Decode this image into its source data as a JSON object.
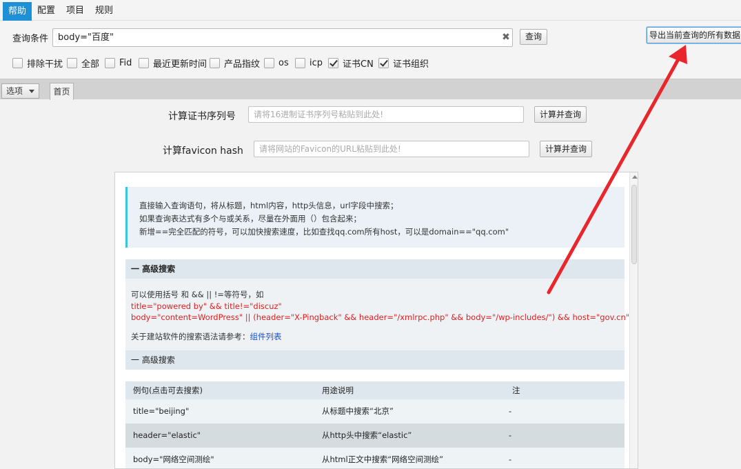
{
  "menu": {
    "items": [
      "帮助",
      "配置",
      "项目",
      "规则"
    ]
  },
  "toolbar": {
    "query_label": "查询条件",
    "query_value": "body=\"百度\"",
    "clear_glyph": "✖",
    "search_button": "查询",
    "export_button": "导出当前查询的所有数据",
    "filters": [
      {
        "label": "排除干扰",
        "checked": false
      },
      {
        "label": "全部",
        "checked": false
      },
      {
        "label": "Fid",
        "checked": false
      },
      {
        "label": "最近更新时间",
        "checked": false
      },
      {
        "label": "产品指纹",
        "checked": false
      },
      {
        "label": "os",
        "checked": false
      },
      {
        "label": "icp",
        "checked": false
      },
      {
        "label": "证书CN",
        "checked": true
      },
      {
        "label": "证书组织",
        "checked": true
      }
    ]
  },
  "tabs": {
    "options_label": "选项",
    "home_label": "首页"
  },
  "cert": {
    "label": "计算证书序列号",
    "placeholder": "请将16进制证书序列号粘贴到此处!",
    "button": "计算并查询"
  },
  "favicon": {
    "label": "计算favicon hash",
    "placeholder": "请将网站的Favicon的URL粘贴到此处!",
    "button": "计算并查询"
  },
  "content": {
    "note_lines": [
      "直接输入查询语句，将从标题，html内容，http头信息，url字段中搜索；",
      "如果查询表达式有多个与或关系，尽量在外面用（）包含起来；",
      "新增==完全匹配的符号，可以加快搜索速度，比如查找qq.com所有host，可以是domain==\"qq.com\""
    ],
    "section1_title": "一  高级搜索",
    "section1_intro": "可以使用括号 和 && || !=等符号，如",
    "example_line1": "title=\"powered by\" && title!=\"discuz\"",
    "example_line2": "body=\"content=WordPress\" || (header=\"X-Pingback\" && header=\"/xmlrpc.php\" && body=\"/wp-includes/\") && host=\"gov.cn\"",
    "ref_text": "关于建站软件的搜索语法请参考：",
    "ref_link": "组件列表",
    "section2_title": "一  高级搜索",
    "table_headers": [
      "例句(点击可去搜索)",
      "用途说明",
      "注"
    ],
    "table_rows": [
      [
        "title=\"beijing\"",
        "从标题中搜索“北京”",
        "-"
      ],
      [
        "header=\"elastic\"",
        "从http头中搜索“elastic”",
        "-"
      ],
      [
        "body=\"网络空间测绘\"",
        "从html正文中搜索“网络空间测绘”",
        "-"
      ]
    ]
  },
  "colors": {
    "menu_active": "#1e90d6",
    "annotation_arrow": "#e8262b",
    "example_text": "#e02020",
    "link": "#1a4fd8"
  }
}
